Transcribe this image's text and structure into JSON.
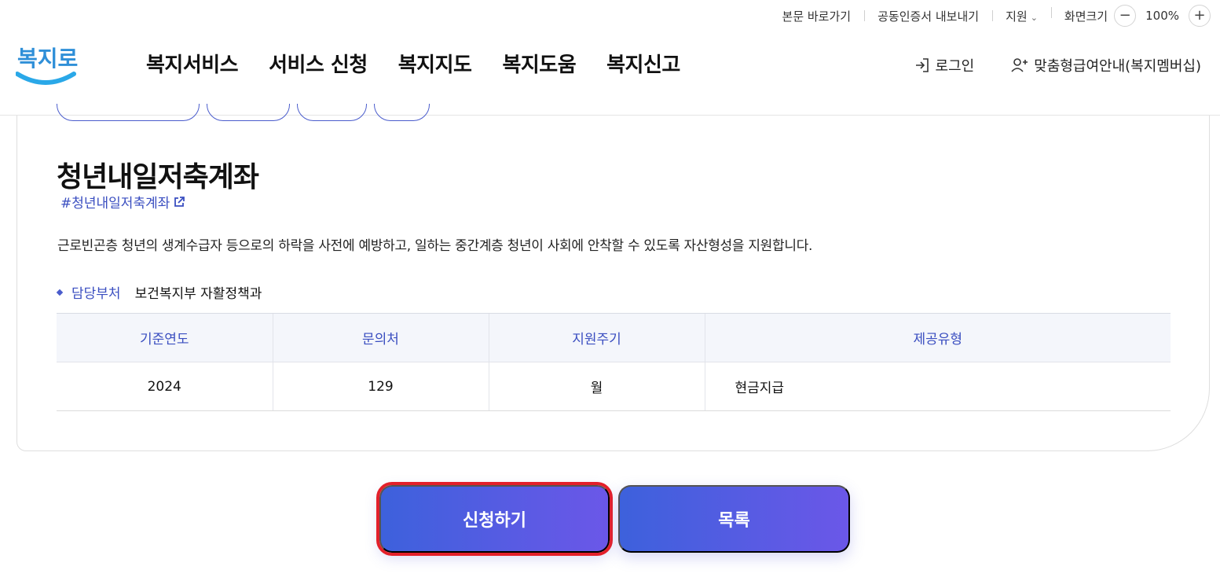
{
  "utility_bar": {
    "skip_link": "본문 바로가기",
    "cert_export": "공동인증서 내보내기",
    "support": "지원",
    "screen_size_label": "화면크기",
    "zoom_out": "−",
    "zoom_level": "100%",
    "zoom_in": "+"
  },
  "header": {
    "logo_text": "복지로",
    "nav": [
      "복지서비스",
      "서비스 신청",
      "복지지도",
      "복지도움",
      "복지신고"
    ],
    "login": "로그인",
    "membership": "맞춤형급여안내(복지멤버십)"
  },
  "service": {
    "title": "청년내일저축계좌",
    "hashtag": "#청년내일저축계좌",
    "description": "근로빈곤층 청년의 생계수급자 등으로의 하락을 사전에 예방하고, 일하는 중간계층 청년이 사회에 안착할 수 있도록 자산형성을 지원합니다.",
    "dept_label": "담당부처",
    "dept_value": "보건복지부 자활정책과"
  },
  "info_table": {
    "headers": [
      "기준연도",
      "문의처",
      "지원주기",
      "제공유형"
    ],
    "row": [
      "2024",
      "129",
      "월",
      "현금지급"
    ]
  },
  "actions": {
    "apply": "신청하기",
    "list": "목록"
  },
  "colors": {
    "accent": "#3a4ec0",
    "button_gradient_start": "#3d61dc",
    "button_gradient_end": "#6b57e8",
    "highlight_border": "#e3202a",
    "logo_blue": "#2aa8e8"
  }
}
